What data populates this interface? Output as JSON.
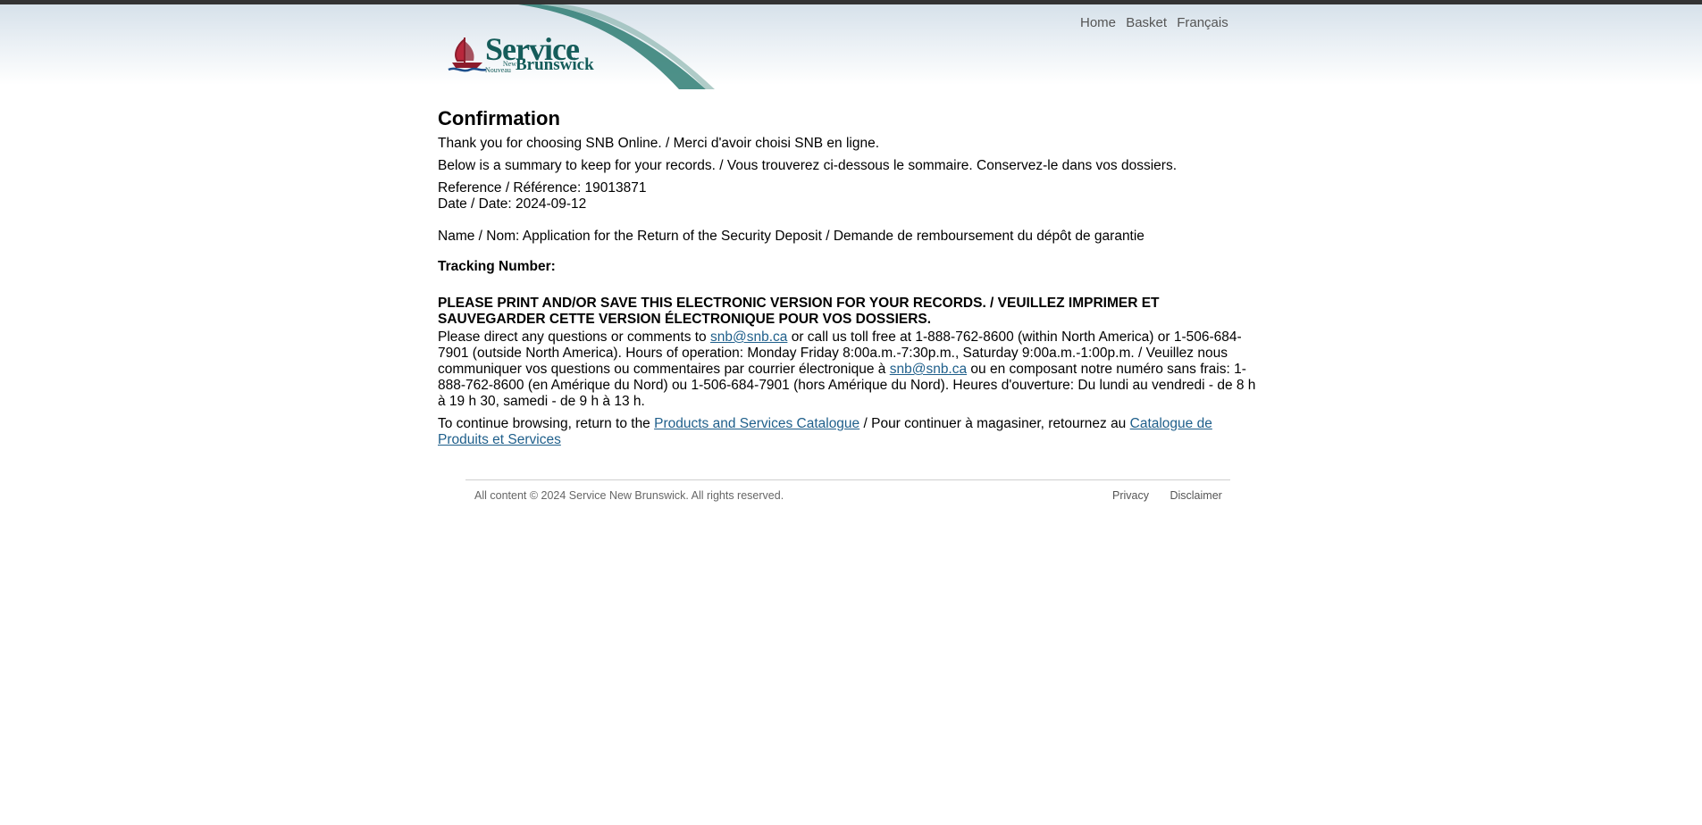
{
  "header": {
    "logo": {
      "word": "Service",
      "new": "New",
      "nouveau": "Nouveau",
      "brunswick": "Brunswick"
    },
    "nav": [
      "Home",
      "Basket",
      "Français"
    ]
  },
  "main": {
    "title": "Confirmation",
    "thank_you": "Thank you for choosing SNB Online. / Merci d'avoir choisi SNB en ligne.",
    "summary": "Below is a summary to keep for your records. / Vous trouverez ci-dessous le sommaire. Conservez-le dans vos dossiers.",
    "reference": "Reference / Référence: 19013871",
    "date": "Date / Date: 2024-09-12",
    "name": "Name / Nom: Application for the Return of the Security Deposit / Demande de remboursement du dépôt de garantie",
    "tracking_label": "Tracking Number:",
    "print_notice": "PLEASE PRINT AND/OR SAVE THIS ELECTRONIC VERSION FOR YOUR RECORDS. / VEUILLEZ IMPRIMER ET SAUVEGARDER CETTE VERSION ÉLECTRONIQUE POUR VOS DOSSIERS.",
    "contact": {
      "part1": "Please direct any questions or comments to ",
      "email1": "snb@snb.ca",
      "part2": " or call us toll free at 1-888-762-8600 (within North America) or 1-506-684-7901 (outside North America). Hours of operation: Monday Friday 8:00a.m.-7:30p.m., Saturday 9:00a.m.-1:00p.m. / Veuillez nous communiquer vos questions ou commentaires par courrier électronique à ",
      "email2": "snb@snb.ca",
      "part3": " ou en composant notre numéro sans frais: 1-888-762-8600 (en Amérique du Nord) ou 1-506-684-7901 (hors Amérique du Nord). Heures d'ouverture: Du lundi au vendredi - de 8 h à 19 h 30, samedi - de 9 h à 13 h."
    },
    "continue": {
      "part1": "To continue browsing, return to the ",
      "link1": "Products and Services Catalogue",
      "part2": " / Pour continuer à magasiner, retournez au ",
      "link2": "Catalogue de Produits et Services"
    }
  },
  "footer": {
    "copyright": "All content © 2024 Service New Brunswick. All rights reserved.",
    "links": [
      "Privacy",
      "Disclaimer"
    ]
  },
  "colors": {
    "brand_teal": "#155c5a",
    "link": "#1f5f8b",
    "logo_red": "#8c1c2c"
  }
}
